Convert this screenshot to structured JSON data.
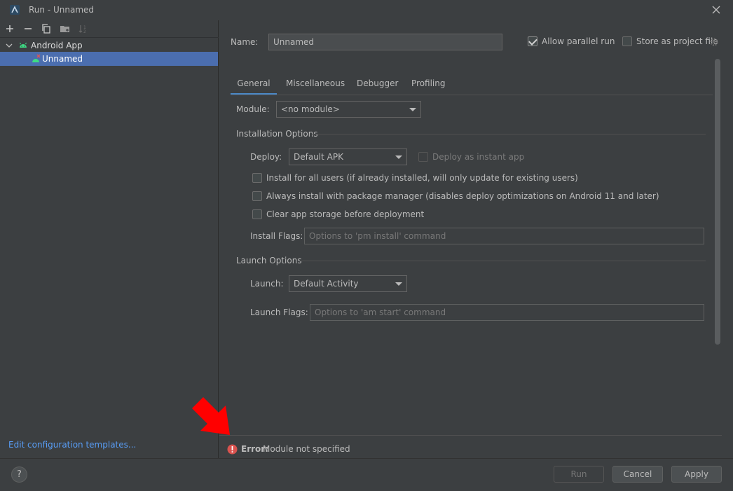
{
  "window": {
    "title": "Run - Unnamed"
  },
  "toolbar": {
    "icons": [
      "plus-icon",
      "minus-icon",
      "copy-icon",
      "new-folder-icon",
      "sort-icon"
    ]
  },
  "tree": {
    "group_label": "Android App",
    "item_label": "Unnamed"
  },
  "left_footer": {
    "edit_templates": "Edit configuration templates..."
  },
  "config": {
    "name_label": "Name:",
    "name_value": "Unnamed",
    "allow_parallel_label": "Allow parallel run",
    "allow_parallel_checked": true,
    "store_project_label": "Store as project file",
    "store_project_checked": false
  },
  "tabs": [
    {
      "label": "General",
      "active": true
    },
    {
      "label": "Miscellaneous",
      "active": false
    },
    {
      "label": "Debugger",
      "active": false
    },
    {
      "label": "Profiling",
      "active": false
    }
  ],
  "general": {
    "module_label": "Module:",
    "module_value": "<no module>",
    "installation_header": "Installation Options",
    "deploy_label": "Deploy:",
    "deploy_value": "Default APK",
    "instant_app_label": "Deploy as instant app",
    "install_all_users_label": "Install for all users (if already installed, will only update for existing users)",
    "package_manager_label": "Always install with package manager (disables deploy optimizations on Android 11 and later)",
    "clear_storage_label": "Clear app storage before deployment",
    "install_flags_label": "Install Flags:",
    "install_flags_placeholder": "Options to 'pm install' command",
    "launch_header": "Launch Options",
    "launch_label": "Launch:",
    "launch_value": "Default Activity",
    "launch_flags_label": "Launch Flags:",
    "launch_flags_placeholder": "Options to 'am start' command"
  },
  "error": {
    "prefix": "Error:",
    "message": "Module not specified"
  },
  "buttons": {
    "help": "?",
    "run": "Run",
    "cancel": "Cancel",
    "apply": "Apply"
  },
  "colors": {
    "background": "#3c3f41",
    "selection": "#4b6eaf",
    "link": "#589df6",
    "error_icon": "#d9534f",
    "annotation_arrow": "#ff0000",
    "android_green": "#3ddc84"
  }
}
